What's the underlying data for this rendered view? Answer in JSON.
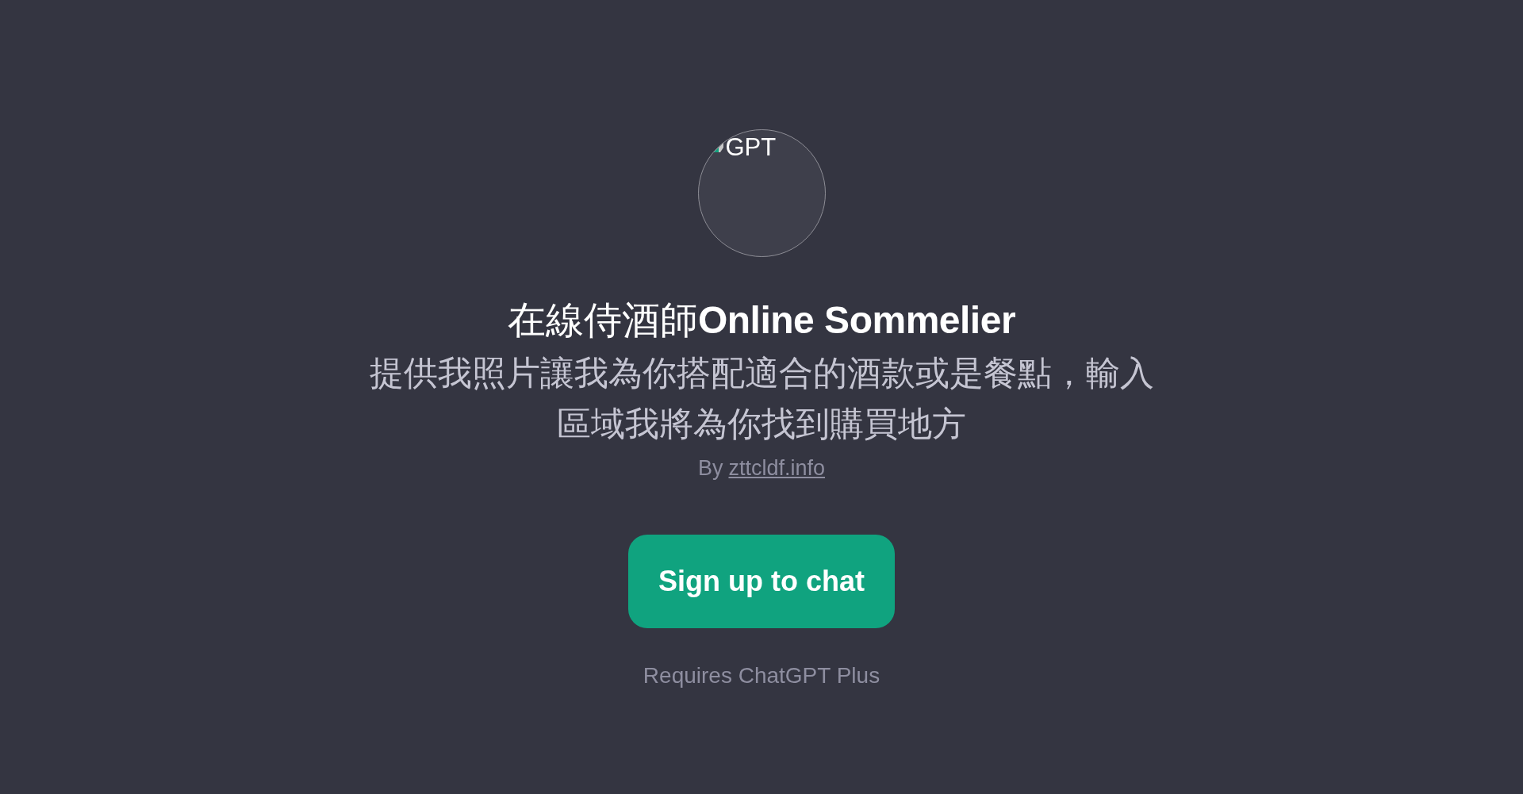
{
  "avatar": {
    "alt_text": "GPT"
  },
  "title": {
    "name_zh": "在線侍酒師",
    "name_en": "Online Sommelier"
  },
  "description": "提供我照片讓我為你搭配適合的酒款或是餐點，輸入區域我將為你找到購買地方",
  "author": {
    "prefix": "By",
    "link": "zttcldf.info"
  },
  "signup_button": "Sign up to chat",
  "requirement": "Requires ChatGPT Plus"
}
